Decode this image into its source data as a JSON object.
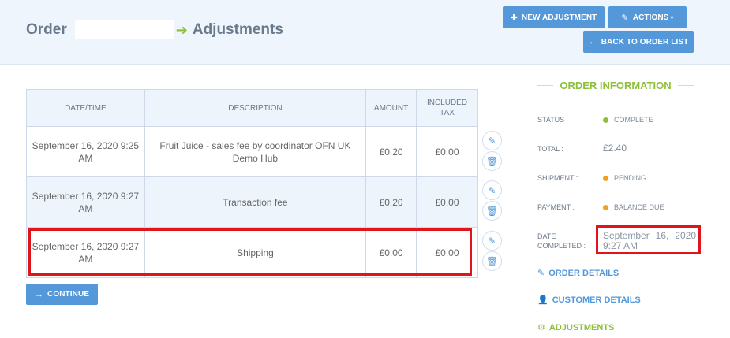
{
  "header": {
    "title_prefix": "Order",
    "title_suffix": "Adjustments",
    "arrow": "➔",
    "buttons": {
      "new_adjustment": "NEW ADJUSTMENT",
      "actions": "ACTIONS",
      "back_to_order_list": "BACK TO ORDER LIST"
    }
  },
  "table": {
    "columns": [
      "DATE/TIME",
      "DESCRIPTION",
      "AMOUNT",
      "INCLUDED TAX"
    ],
    "rows": [
      {
        "date": "September 16, 2020 9:25 AM",
        "description": "Fruit Juice - sales fee by coordinator OFN UK Demo Hub",
        "amount": "£0.20",
        "tax": "£0.00"
      },
      {
        "date": "September 16, 2020 9:27 AM",
        "description": "Transaction fee",
        "amount": "£0.20",
        "tax": "£0.00"
      },
      {
        "date": "September 16, 2020 9:27 AM",
        "description": "Shipping",
        "amount": "£0.00",
        "tax": "£0.00"
      }
    ]
  },
  "continue_label": "CONTINUE",
  "sidebar": {
    "title": "ORDER INFORMATION",
    "status_label": "STATUS",
    "status_value": "COMPLETE",
    "total_label": "TOTAL :",
    "total_value": "£2.40",
    "shipment_label": "SHIPMENT :",
    "shipment_value": "PENDING",
    "payment_label": "PAYMENT :",
    "payment_value": "BALANCE DUE",
    "date_label_1": "DATE",
    "date_label_2": "COMPLETED :",
    "date_value": "September 16, 2020 9:27 AM",
    "links": {
      "order_details": "ORDER DETAILS",
      "customer_details": "CUSTOMER DETAILS",
      "adjustments": "ADJUSTMENTS"
    }
  },
  "colors": {
    "accent_blue": "#5498da",
    "accent_green": "#8dbf3b",
    "status_complete": "#8dbf3b",
    "status_pending": "#f0a21f",
    "highlight_red": "#e0151b"
  }
}
